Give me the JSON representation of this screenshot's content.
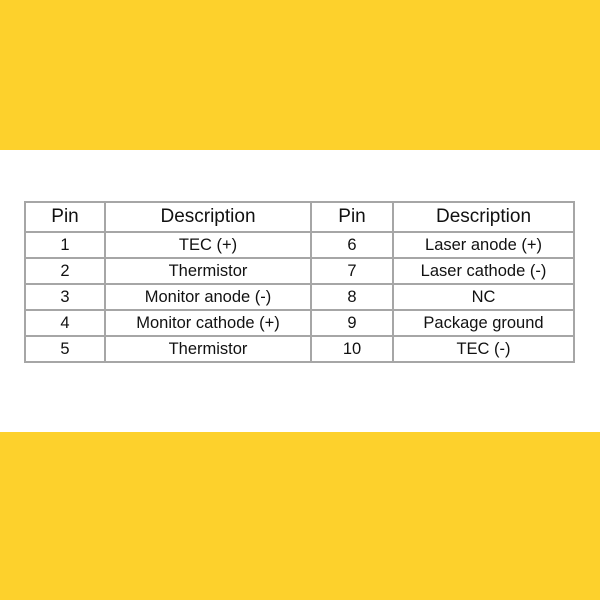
{
  "colors": {
    "band": "#fdd12c",
    "background": "#ffffff",
    "table_border": "#a6a6a6",
    "text": "#111111"
  },
  "table": {
    "headers": [
      "Pin",
      "Description",
      "Pin",
      "Description"
    ],
    "rows": [
      [
        "1",
        "TEC (+)",
        "6",
        "Laser anode (+)"
      ],
      [
        "2",
        "Thermistor",
        "7",
        "Laser cathode (-)"
      ],
      [
        "3",
        "Monitor anode (-)",
        "8",
        "NC"
      ],
      [
        "4",
        "Monitor cathode (+)",
        "9",
        "Package ground"
      ],
      [
        "5",
        "Thermistor",
        "10",
        "TEC (-)"
      ]
    ]
  }
}
